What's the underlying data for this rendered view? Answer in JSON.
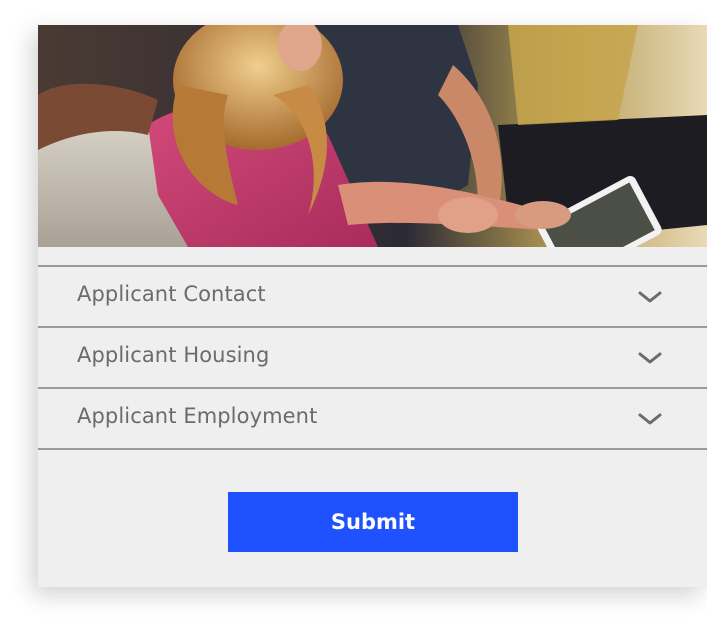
{
  "hero": {
    "icon": "couple-with-tablet-photo"
  },
  "sections": [
    {
      "label": "Applicant Contact",
      "icon": "chevron-down-icon"
    },
    {
      "label": "Applicant Housing",
      "icon": "chevron-down-icon"
    },
    {
      "label": "Applicant Employment",
      "icon": "chevron-down-icon"
    }
  ],
  "submit": {
    "label": "Submit"
  },
  "colors": {
    "accent": "#1f51ff",
    "card": "#efefef",
    "text": "#6b6b6b",
    "divider": "#9a9a9a"
  }
}
